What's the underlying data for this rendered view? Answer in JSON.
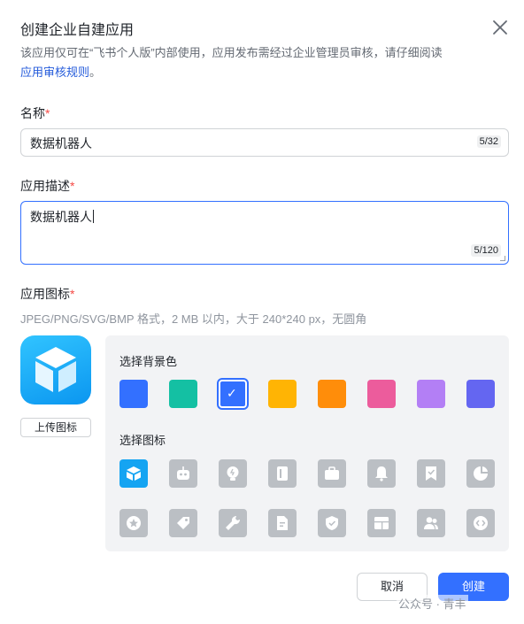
{
  "dialog": {
    "title": "创建企业自建应用",
    "notice_text": "该应用仅可在“飞书个人版”内部使用，应用发布需经过企业管理员审核，请仔细阅读",
    "notice_link": "应用审核规则",
    "notice_end": "。"
  },
  "fields": {
    "name": {
      "label": "名称",
      "required_mark": "*",
      "value": "数据机器人",
      "counter": "5/32"
    },
    "description": {
      "label": "应用描述",
      "required_mark": "*",
      "value": "数据机器人",
      "counter": "5/120"
    },
    "icon": {
      "label": "应用图标",
      "required_mark": "*",
      "hint": "JPEG/PNG/SVG/BMP 格式，2 MB 以内，大于 240*240 px，无圆角"
    }
  },
  "upload_button": "上传图标",
  "panel": {
    "bg_label": "选择背景色",
    "icon_label": "选择图标",
    "colors": [
      "#3370ff",
      "#14c0a3",
      "#3370ff",
      "#ffb404",
      "#ff8d0a",
      "#ec5c9c",
      "#b37ff5",
      "#6466f1"
    ],
    "selected_color_index": 2,
    "icons": [
      "cube-icon",
      "robot-icon",
      "bulb-icon",
      "book-icon",
      "briefcase-icon",
      "bell-icon",
      "bookmark-check-icon",
      "pie-icon",
      "star-badge-icon",
      "tag-icon",
      "wrench-icon",
      "document-icon",
      "shield-check-icon",
      "layout-icon",
      "people-icon",
      "code-icon"
    ],
    "selected_icon_index": 0
  },
  "buttons": {
    "cancel": "取消",
    "create": "创建"
  },
  "watermark": "公众号 · 青丰"
}
